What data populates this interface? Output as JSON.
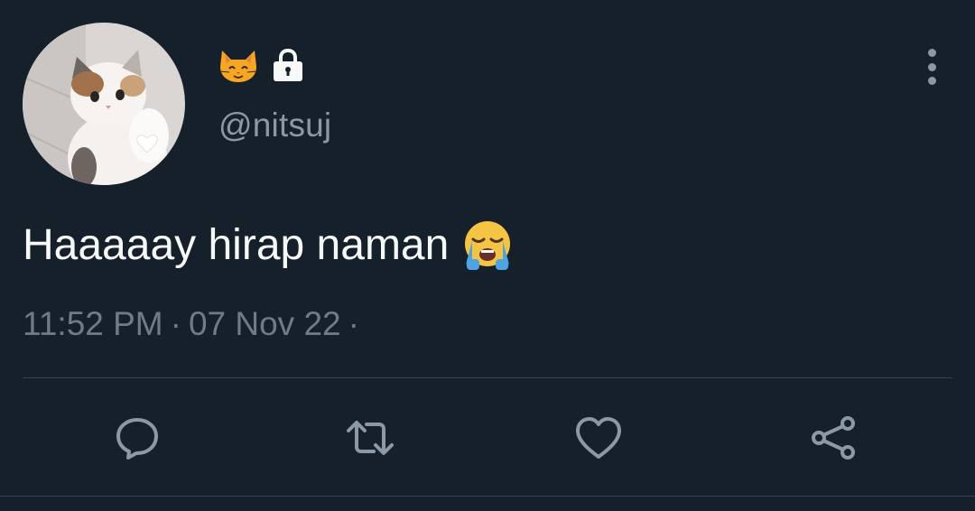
{
  "user": {
    "display_name_icons": [
      "cat-face-emoji",
      "lock-icon"
    ],
    "handle": "@nitsuj"
  },
  "tweet": {
    "text": "Haaaaay hirap naman",
    "emoji": "loudly-crying-face-emoji",
    "time": "11:52 PM",
    "separator1": "·",
    "date": "07 Nov 22",
    "separator2": "·"
  },
  "actions": [
    "reply-icon",
    "retweet-icon",
    "like-icon",
    "share-icon"
  ],
  "colors": {
    "background": "#15202b",
    "primary_text": "#f7f9f9",
    "secondary_text": "#8b98a5",
    "divider": "#38444d"
  }
}
